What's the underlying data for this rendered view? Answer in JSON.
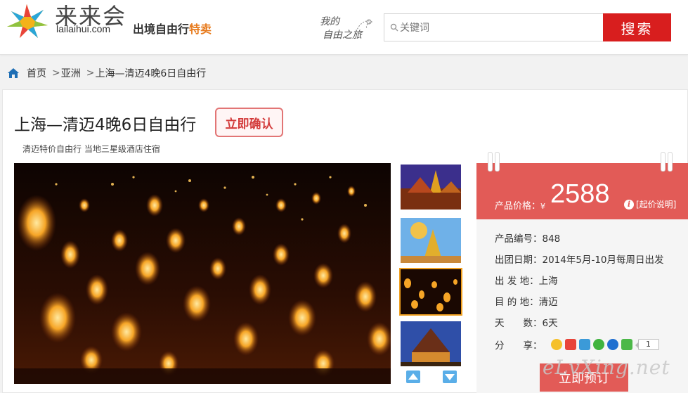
{
  "header": {
    "logo_name": "来来会",
    "logo_domain": "lailaihui.com",
    "slogan_main": "出境自由行",
    "slogan_hot": "特卖",
    "tagline_line1": "我的",
    "tagline_line2": "自由之旅",
    "search_placeholder": "关键词",
    "search_button": "搜索"
  },
  "breadcrumb": {
    "home": "首页",
    "sep1": ">",
    "region": "亚洲",
    "sep2": ">",
    "current": "上海—清迈4晚6日自由行"
  },
  "product": {
    "title": "上海—清迈4晚6日自由行",
    "confirm_label": "立即确认",
    "subtitle": "清迈特价自由行 当地三星级酒店住宿"
  },
  "price": {
    "label": "产品价格：",
    "currency": "¥",
    "value": "2588",
    "info_label": "[起价说明]"
  },
  "details": [
    {
      "label": "产品编号：",
      "value": "848"
    },
    {
      "label": "出团日期：",
      "value": "2014年5月-10月每周日出发"
    },
    {
      "label": "出 发 地：",
      "value": "上海"
    },
    {
      "label": "目 的 地：",
      "value": "清迈"
    },
    {
      "label": "天　　数：",
      "value": "6天"
    }
  ],
  "share": {
    "label": "分　　享：",
    "icons": [
      "qzone-icon",
      "weibo-icon",
      "tencent-weibo-icon",
      "wechat-icon",
      "renren-icon",
      "more-share-icon"
    ],
    "count": "1"
  },
  "book_label": "立即预订",
  "watermark": "eLvXing.net",
  "colors": {
    "brand_red": "#d81e1e",
    "price_red": "#e25b57",
    "hot_orange": "#e77a1c"
  }
}
